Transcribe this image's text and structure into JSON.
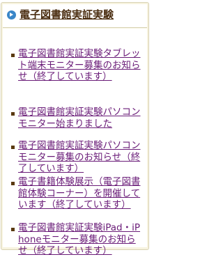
{
  "panel": {
    "title": "電子図書館実証実験",
    "icon": "arrow-circle-icon",
    "colors": {
      "accent_icon": "#3a86c8",
      "link": "#6a1c78",
      "title": "#4a2d10",
      "panel_background": "#f7f3df"
    }
  },
  "news": {
    "items": [
      {
        "text": "電子図書館実証実験タブレット端末モニター募集のお知らせ（終了しています）"
      },
      {
        "text": "電子図書館実証実験パソコンモニター始まりました"
      },
      {
        "text": "電子図書館実証実験パソコンモニター募集のお知らせ（終了しています）"
      },
      {
        "text": "電子書籍体験展示（電子図書館体験コーナー）を開催しています（終了しています）"
      },
      {
        "text": "電子図書館実証実験iPad・iPhoneモニター募集のお知らせ（終了しています）"
      }
    ]
  }
}
